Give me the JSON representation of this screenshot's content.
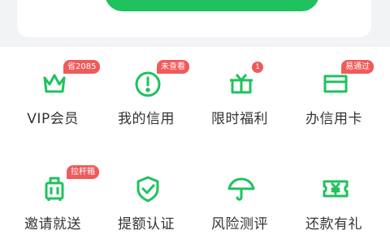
{
  "colors": {
    "accent": "#1fc25e",
    "badge": "#ef5a5a",
    "text": "#333333"
  },
  "grid": {
    "items": [
      {
        "label": "VIP会员",
        "badge": "省2085",
        "icon": "crown-icon"
      },
      {
        "label": "我的信用",
        "badge": "未查看",
        "icon": "alert-circle-icon"
      },
      {
        "label": "限时福利",
        "badge": "1",
        "icon": "gift-icon"
      },
      {
        "label": "办信用卡",
        "badge": "易通过",
        "icon": "credit-card-icon"
      },
      {
        "label": "邀请就送",
        "badge": "拉杆箱",
        "icon": "luggage-icon"
      },
      {
        "label": "提额认证",
        "badge": "",
        "icon": "shield-check-icon"
      },
      {
        "label": "风险测评",
        "badge": "",
        "icon": "umbrella-icon"
      },
      {
        "label": "还款有礼",
        "badge": "",
        "icon": "yen-ticket-icon"
      }
    ]
  }
}
